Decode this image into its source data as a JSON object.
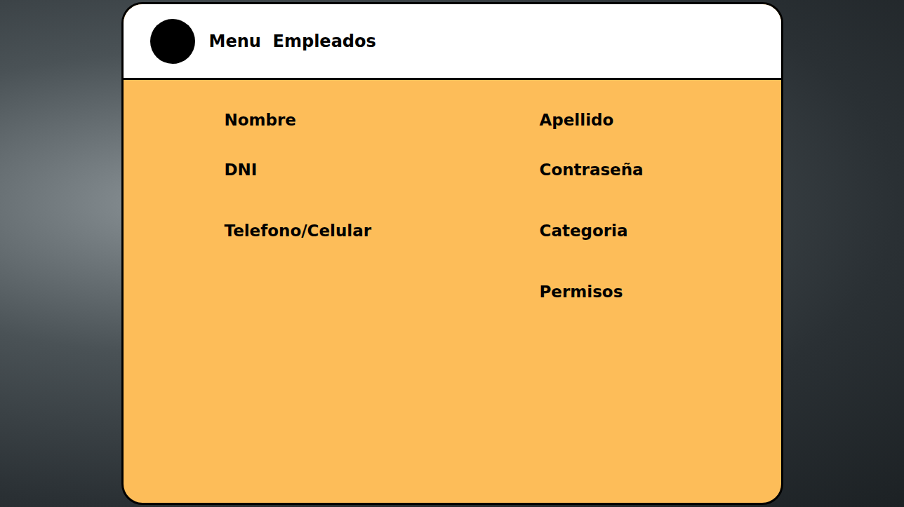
{
  "header": {
    "title": "Menu  Empleados"
  },
  "form": {
    "left_fields": [
      {
        "label": "Nombre"
      },
      {
        "label": "DNI"
      },
      {
        "label": "Telefono/Celular"
      }
    ],
    "right_fields": [
      {
        "label": "Apellido"
      },
      {
        "label": "Contraseña"
      },
      {
        "label": "Categoria"
      },
      {
        "label": "Permisos"
      }
    ]
  }
}
